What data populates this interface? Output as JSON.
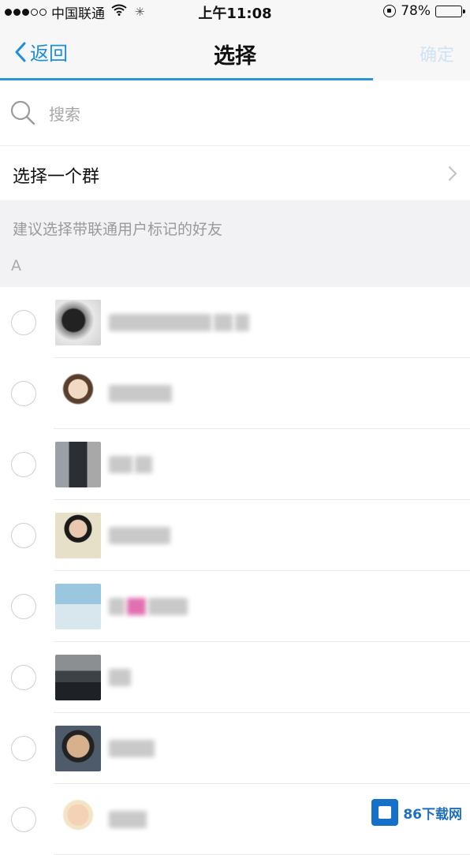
{
  "status_bar": {
    "carrier": "中国联通",
    "time": "上午11:08",
    "battery": "78%",
    "battery_level": 0.78
  },
  "nav": {
    "back_label": "返回",
    "title": "选择",
    "done_label": "确定"
  },
  "search": {
    "placeholder": "搜索",
    "value": ""
  },
  "select_group": {
    "label": "选择一个群"
  },
  "hint": {
    "text": "建议选择带联通用户标记的好友",
    "section_letter": "A"
  },
  "contacts": [
    {
      "name": "",
      "selected": false
    },
    {
      "name": "",
      "selected": false
    },
    {
      "name": "",
      "selected": false
    },
    {
      "name": "",
      "selected": false
    },
    {
      "name": "",
      "selected": false
    },
    {
      "name": "",
      "selected": false
    },
    {
      "name": "",
      "selected": false
    },
    {
      "name": "",
      "selected": false
    }
  ],
  "watermark": {
    "text": "86下载网"
  },
  "colors": {
    "accent": "#2a97d4",
    "back_text": "#1f8fd6"
  }
}
